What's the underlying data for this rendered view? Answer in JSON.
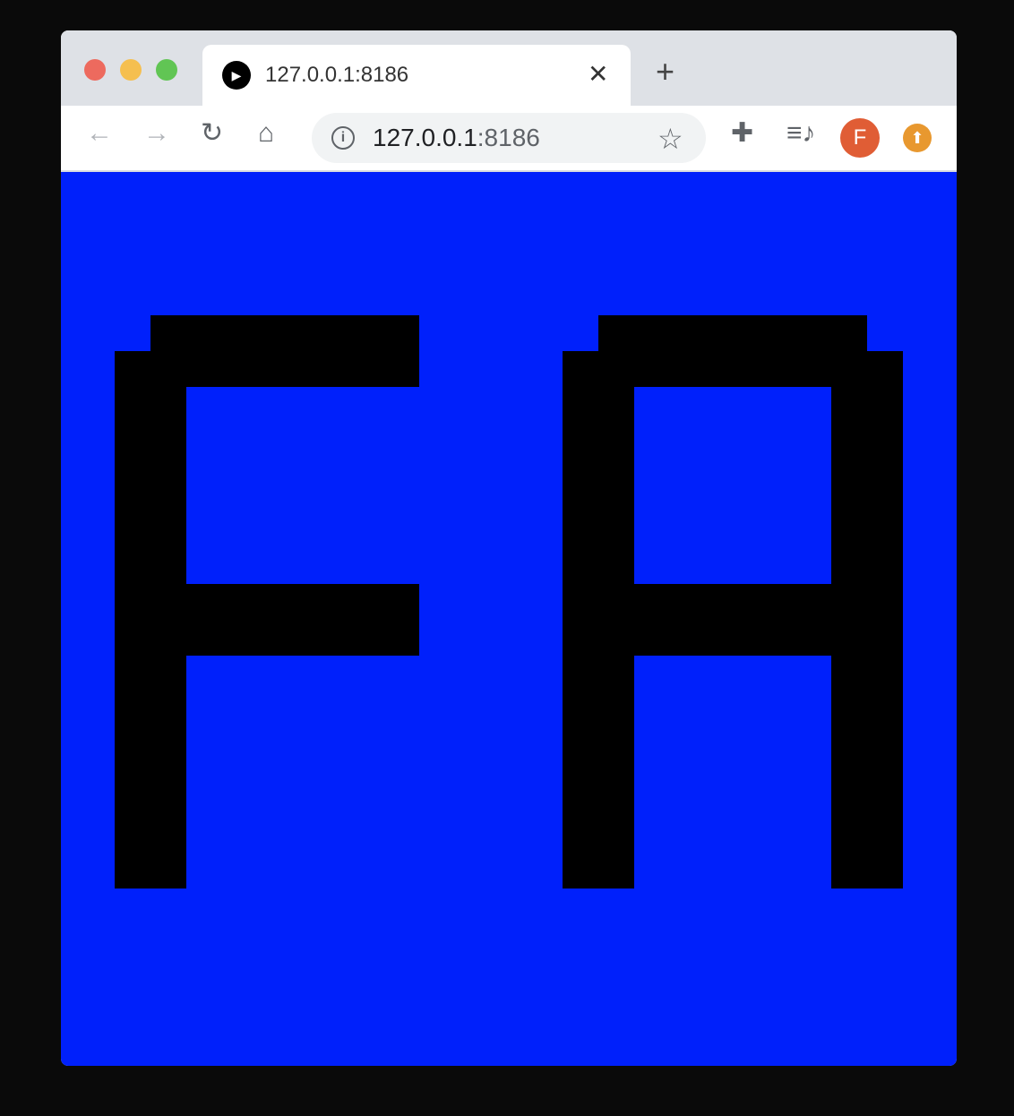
{
  "browser": {
    "tab_title": "127.0.0.1:8186",
    "url_host": "127.0.0.1",
    "url_port": ":8186",
    "profile_initial": "F",
    "colors": {
      "background": "#0020fb",
      "glyph": "#000000",
      "avatar": "#e05d35"
    }
  },
  "page": {
    "pixel_text": "FA"
  }
}
